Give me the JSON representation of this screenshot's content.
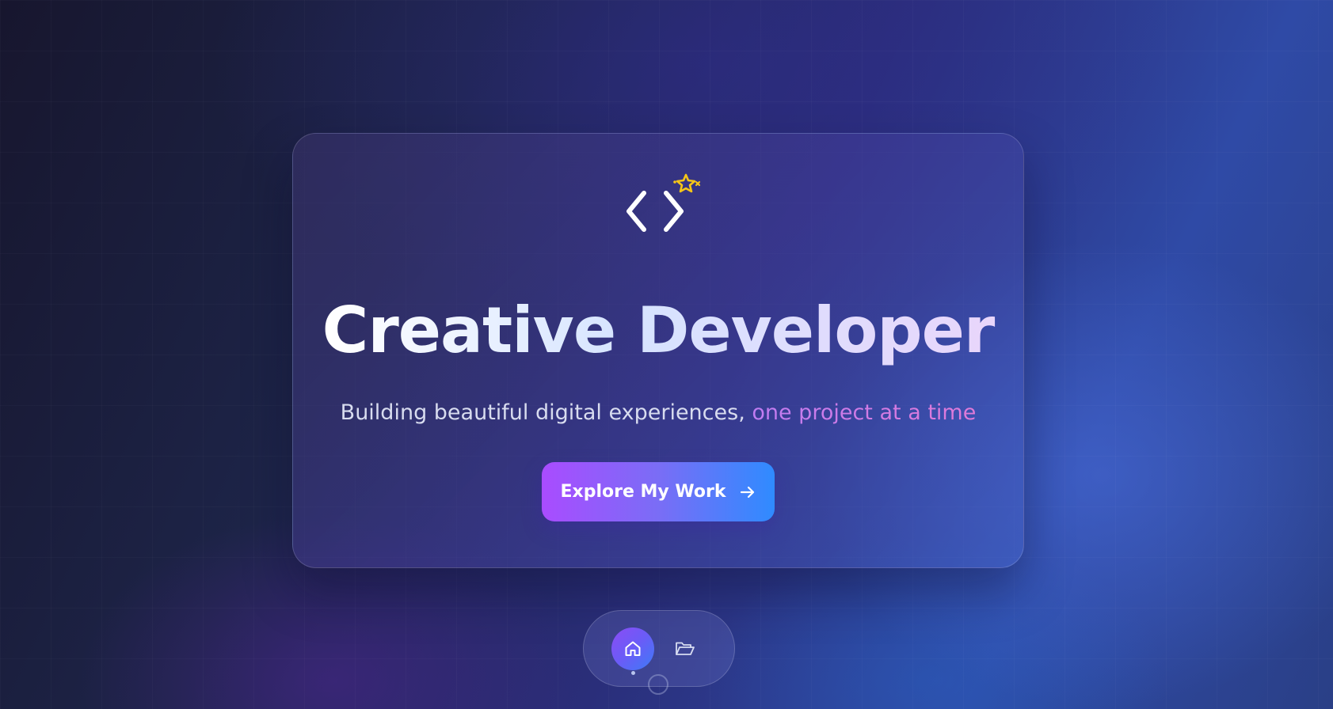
{
  "hero": {
    "icon": "code-brackets-icon",
    "sparkle_icon": "sparkle-icon",
    "title": "Creative Developer",
    "subtitle_main": "Building beautiful digital experiences, ",
    "subtitle_accent": "one project at a time",
    "cta_label": "Explore My Work",
    "cta_icon": "arrow-right-icon"
  },
  "dock": {
    "items": [
      {
        "icon": "home-icon",
        "active": true
      },
      {
        "icon": "folder-open-icon",
        "active": false
      }
    ]
  },
  "colors": {
    "accent_purple": "#a94cff",
    "accent_blue": "#2f8bff",
    "sparkle": "#f5c518",
    "subtitle_accent": "#d07ae6"
  }
}
